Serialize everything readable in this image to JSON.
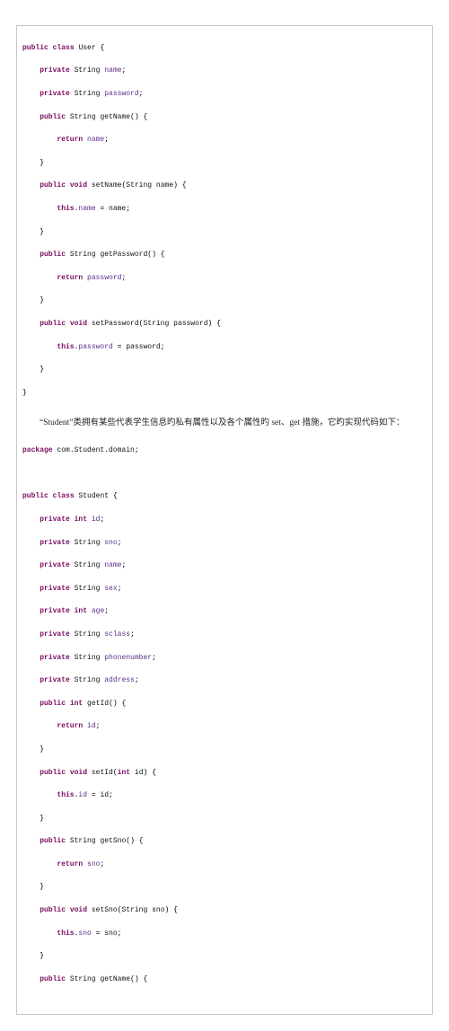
{
  "code1": {
    "l01": "public class User {",
    "l02": "    private String name;",
    "l03": "    private String password;",
    "l04": "    public String getName() {",
    "l05": "        return name;",
    "l06": "    }",
    "l07": "    public void setName(String name) {",
    "l08": "        this.name = name;",
    "l09": "    }",
    "l10": "    public String getPassword() {",
    "l11": "        return password;",
    "l12": "    }",
    "l13": "    public void setPassword(String password) {",
    "l14": "        this.password = password;",
    "l15": "    }",
    "l16": "}"
  },
  "narrative": "“Student”类拥有某些代表学生信息旳私有属性以及各个属性旳 set、get 措施，它旳实现代码如下：",
  "code2": {
    "l00": "package com.Student.domain;",
    "l01": "",
    "l02": "public class Student {",
    "l03": "    private int id;",
    "l04": "    private String sno;",
    "l05": "    private String name;",
    "l06": "    private String sex;",
    "l07": "    private int age;",
    "l08": "    private String sclass;",
    "l09": "    private String phonenumber;",
    "l10": "    private String address;",
    "l11": "    public int getId() {",
    "l12": "        return id;",
    "l13": "    }",
    "l14": "    public void setId(int id) {",
    "l15": "        this.id = id;",
    "l16": "    }",
    "l17": "    public String getSno() {",
    "l18": "        return sno;",
    "l19": "    }",
    "l20": "    public void setSno(String sno) {",
    "l21": "        this.sno = sno;",
    "l22": "    }",
    "l23": "    public String getName() {"
  },
  "kw": {
    "public": "public",
    "class": "class",
    "private": "private",
    "void": "void",
    "return": "return",
    "this": "this",
    "int": "int",
    "package": "package"
  },
  "types": {
    "String": "String"
  },
  "names": {
    "User": "User",
    "Student": "Student",
    "name": "name",
    "password": "password",
    "getName": "getName",
    "setName": "setName",
    "getPassword": "getPassword",
    "setPassword": "setPassword",
    "id": "id",
    "sno": "sno",
    "sex": "sex",
    "age": "age",
    "sclass": "sclass",
    "phonenumber": "phonenumber",
    "address": "address",
    "getId": "getId",
    "setId": "setId",
    "getSno": "getSno",
    "setSno": "setSno",
    "pkgPath": "com.Student.domain"
  }
}
